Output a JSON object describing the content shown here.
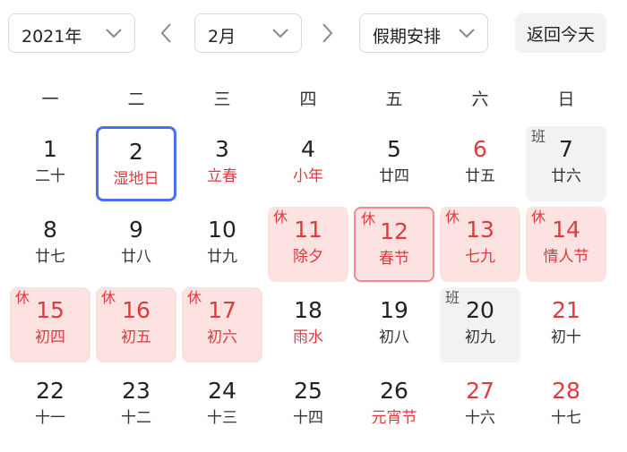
{
  "toolbar": {
    "year": "2021年",
    "month": "2月",
    "mode": "假期安排",
    "today_label": "返回今天"
  },
  "weekdays": [
    "一",
    "二",
    "三",
    "四",
    "五",
    "六",
    "日"
  ],
  "days": [
    {
      "num": "1",
      "lunar": "二十",
      "tag": ""
    },
    {
      "num": "2",
      "lunar": "湿地日",
      "tag": ""
    },
    {
      "num": "3",
      "lunar": "立春",
      "tag": ""
    },
    {
      "num": "4",
      "lunar": "小年",
      "tag": ""
    },
    {
      "num": "5",
      "lunar": "廿四",
      "tag": ""
    },
    {
      "num": "6",
      "lunar": "廿五",
      "tag": ""
    },
    {
      "num": "7",
      "lunar": "廿六",
      "tag": "班"
    },
    {
      "num": "8",
      "lunar": "廿七",
      "tag": ""
    },
    {
      "num": "9",
      "lunar": "廿八",
      "tag": ""
    },
    {
      "num": "10",
      "lunar": "廿九",
      "tag": ""
    },
    {
      "num": "11",
      "lunar": "除夕",
      "tag": "休"
    },
    {
      "num": "12",
      "lunar": "春节",
      "tag": "休"
    },
    {
      "num": "13",
      "lunar": "七九",
      "tag": "休"
    },
    {
      "num": "14",
      "lunar": "情人节",
      "tag": "休"
    },
    {
      "num": "15",
      "lunar": "初四",
      "tag": "休"
    },
    {
      "num": "16",
      "lunar": "初五",
      "tag": "休"
    },
    {
      "num": "17",
      "lunar": "初六",
      "tag": "休"
    },
    {
      "num": "18",
      "lunar": "雨水",
      "tag": ""
    },
    {
      "num": "19",
      "lunar": "初八",
      "tag": ""
    },
    {
      "num": "20",
      "lunar": "初九",
      "tag": "班"
    },
    {
      "num": "21",
      "lunar": "初十",
      "tag": ""
    },
    {
      "num": "22",
      "lunar": "十一",
      "tag": ""
    },
    {
      "num": "23",
      "lunar": "十二",
      "tag": ""
    },
    {
      "num": "24",
      "lunar": "十三",
      "tag": ""
    },
    {
      "num": "25",
      "lunar": "十四",
      "tag": ""
    },
    {
      "num": "26",
      "lunar": "元宵节",
      "tag": ""
    },
    {
      "num": "27",
      "lunar": "十六",
      "tag": ""
    },
    {
      "num": "28",
      "lunar": "十七",
      "tag": ""
    }
  ],
  "colors": {
    "holiday_red": "#e0393e",
    "holiday_bg": "#fde2e2",
    "selected_border": "#4e6ef2",
    "workday_bg": "#f2f2f2"
  }
}
